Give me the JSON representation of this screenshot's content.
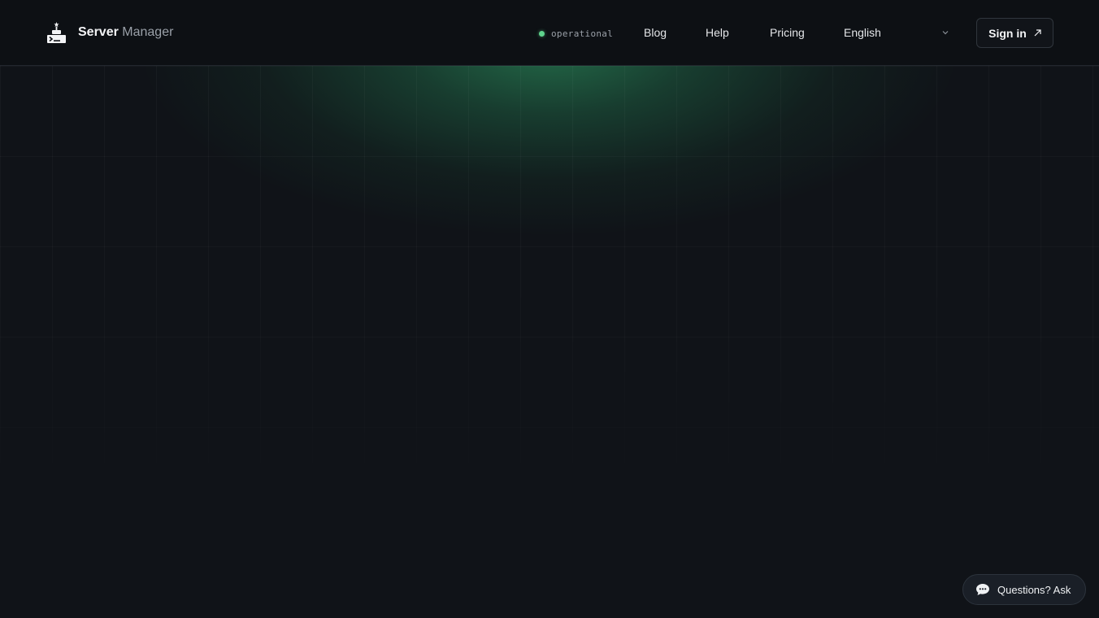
{
  "brand": {
    "name_strong": "Server",
    "name_light": "Manager",
    "icon": "server-manager-logo-icon"
  },
  "status": {
    "text": "operational",
    "color": "#5fd38d"
  },
  "nav": {
    "blog": "Blog",
    "help": "Help",
    "pricing": "Pricing"
  },
  "language": {
    "selected": "English",
    "icon": "chevron-down-icon"
  },
  "signin": {
    "label": "Sign in",
    "icon": "external-arrow-icon"
  },
  "chat": {
    "label": "Questions? Ask",
    "icon": "chat-bubble-icon"
  },
  "colors": {
    "background": "#101318",
    "header": "#0d1014",
    "accent_glow": "#267850"
  }
}
